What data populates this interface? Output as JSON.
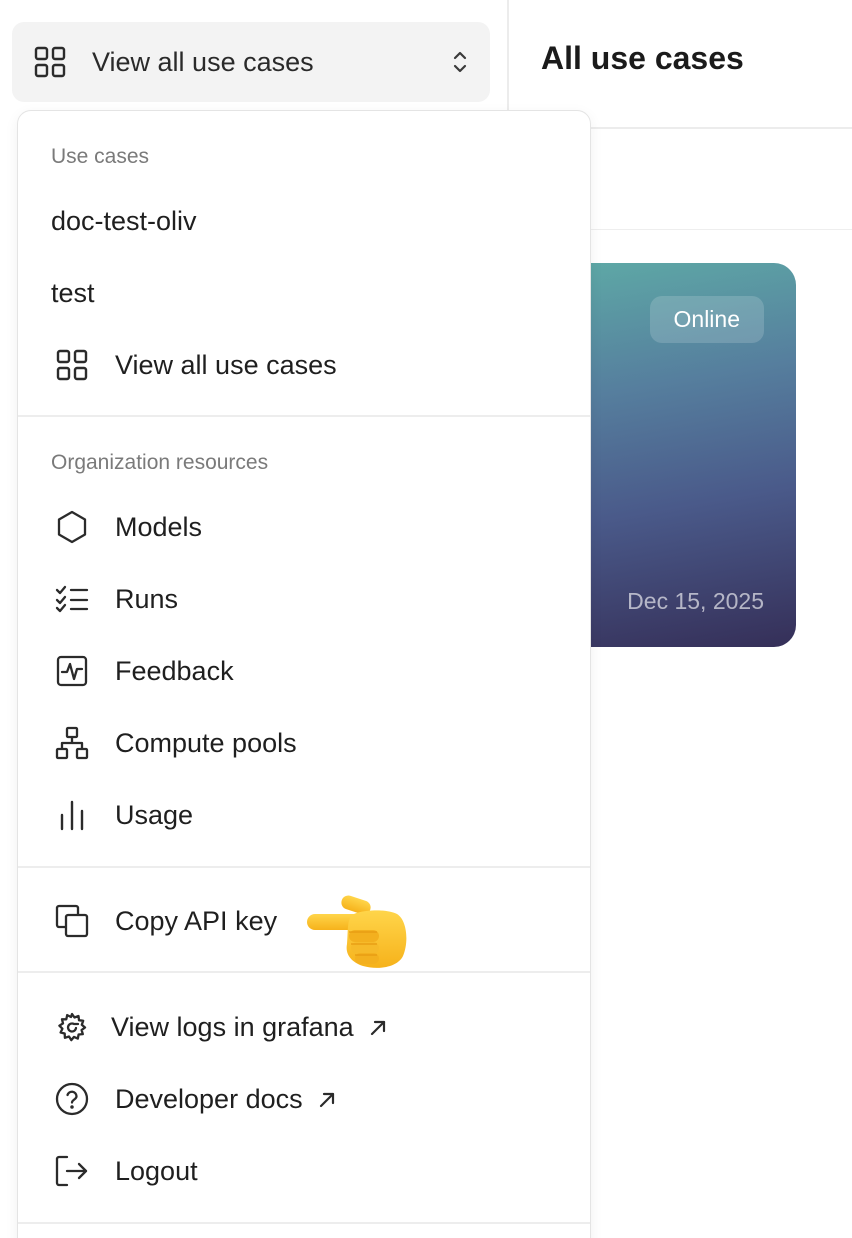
{
  "selector": {
    "label": "View all use cases",
    "icon": "grid-icon"
  },
  "header": {
    "title": "All use cases"
  },
  "card": {
    "status": "Online",
    "date": "Dec 15, 2025"
  },
  "menu": {
    "use_cases": {
      "title": "Use cases",
      "items": [
        {
          "label": "doc-test-oliv"
        },
        {
          "label": "test"
        },
        {
          "label": "View all use cases",
          "icon": "grid-icon"
        }
      ]
    },
    "org": {
      "title": "Organization resources",
      "items": [
        {
          "label": "Models",
          "icon": "hexagon-icon"
        },
        {
          "label": "Runs",
          "icon": "checklist-icon"
        },
        {
          "label": "Feedback",
          "icon": "activity-icon"
        },
        {
          "label": "Compute pools",
          "icon": "hierarchy-icon"
        },
        {
          "label": "Usage",
          "icon": "bar-chart-icon"
        }
      ]
    },
    "copy_api_key": {
      "label": "Copy API key",
      "icon": "copy-icon"
    },
    "links": [
      {
        "label": "View logs in grafana",
        "icon": "grafana-icon"
      },
      {
        "label": "Developer docs",
        "icon": "help-circle-icon"
      },
      {
        "label": "Logout",
        "icon": "logout-icon"
      }
    ]
  },
  "colors": {
    "accent_gradient": [
      "#5ea9a6",
      "#4a5a8a",
      "#352f58"
    ],
    "text": "#1f1f1f",
    "muted": "#7a7a7a"
  }
}
